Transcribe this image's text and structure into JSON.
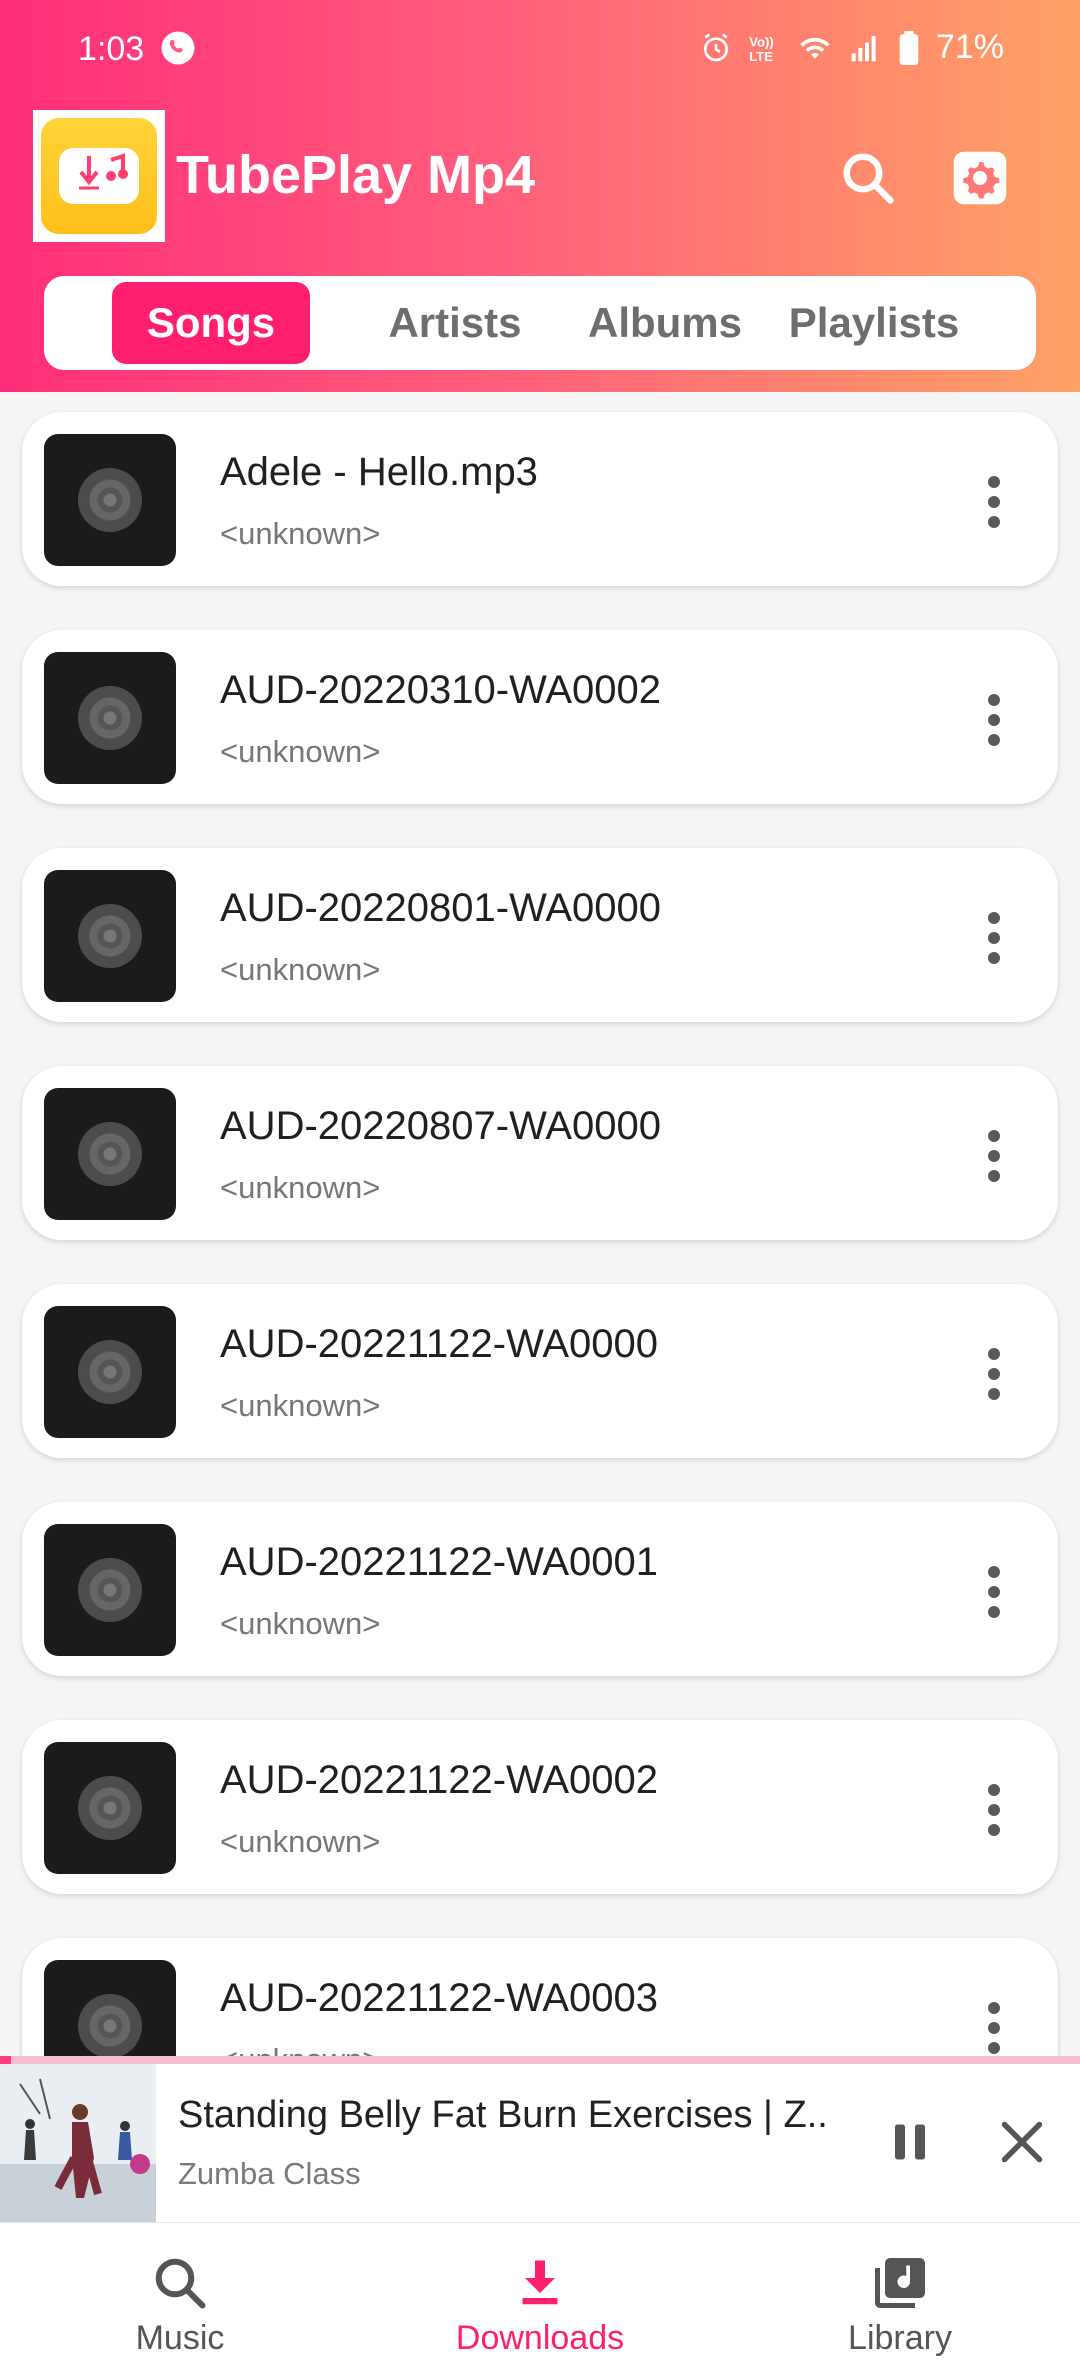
{
  "status_bar": {
    "time": "1:03",
    "battery": "71%",
    "icons": [
      "whatsapp-call-icon",
      "alarm-icon",
      "volte-icon",
      "wifi-icon",
      "signal-icon",
      "battery-icon"
    ]
  },
  "app": {
    "title": "TubePlay Mp4",
    "icons": [
      "app-logo-icon",
      "search-icon",
      "settings-icon"
    ],
    "colors": {
      "accent": "#ff1f6e",
      "gradient_start": "#ff2d7a",
      "gradient_end": "#ffa267"
    }
  },
  "tabs": [
    {
      "label": "Songs",
      "active": true
    },
    {
      "label": "Artists",
      "active": false
    },
    {
      "label": "Albums",
      "active": false
    },
    {
      "label": "Playlists",
      "active": false
    }
  ],
  "songs": [
    {
      "title": "Adele - Hello.mp3",
      "artist": "<unknown>"
    },
    {
      "title": "AUD-20220310-WA0002",
      "artist": "<unknown>"
    },
    {
      "title": "AUD-20220801-WA0000",
      "artist": "<unknown>"
    },
    {
      "title": "AUD-20220807-WA0000",
      "artist": "<unknown>"
    },
    {
      "title": "AUD-20221122-WA0000",
      "artist": "<unknown>"
    },
    {
      "title": "AUD-20221122-WA0001",
      "artist": "<unknown>"
    },
    {
      "title": "AUD-20221122-WA0002",
      "artist": "<unknown>"
    },
    {
      "title": "AUD-20221122-WA0003",
      "artist": "<unknown>"
    }
  ],
  "now_playing": {
    "title": "Standing Belly Fat Burn Exercises | Z..",
    "subtitle": "Zumba Class",
    "progress": 0.01
  },
  "bottom_nav": [
    {
      "label": "Music",
      "icon": "search-icon",
      "active": false
    },
    {
      "label": "Downloads",
      "icon": "download-icon",
      "active": true
    },
    {
      "label": "Library",
      "icon": "library-music-icon",
      "active": false
    }
  ]
}
